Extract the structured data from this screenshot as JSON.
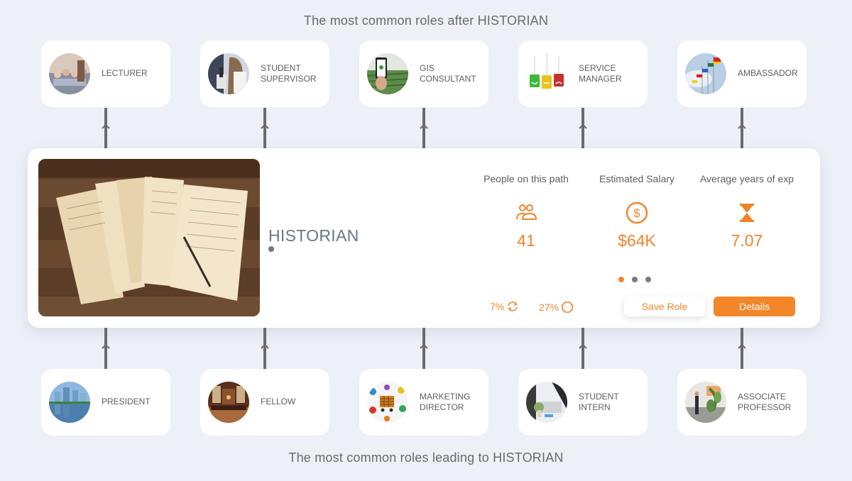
{
  "headings": {
    "top": "The most common roles after HISTORIAN",
    "bottom": "The most common roles leading to HISTORIAN"
  },
  "next_roles": [
    {
      "label": "LECTURER",
      "image": "lecture-hall-audience"
    },
    {
      "label": "STUDENT\nSUPERVISOR",
      "image": "scientist-microscope"
    },
    {
      "label": "GIS\nCONSULTANT",
      "image": "phone-over-field"
    },
    {
      "label": "SERVICE\nMANAGER",
      "image": "smiley-feedback-tags"
    },
    {
      "label": "AMBASSADOR",
      "image": "international-flags"
    }
  ],
  "previous_roles": [
    {
      "label": "PRESIDENT",
      "image": "city-skyline-reflection"
    },
    {
      "label": "FELLOW",
      "image": "library-hall"
    },
    {
      "label": "MARKETING\nDIRECTOR",
      "image": "marketing-icons-collage"
    },
    {
      "label": "STUDENT\nINTERN",
      "image": "office-desk-laptop"
    },
    {
      "label": "ASSOCIATE\nPROFESSOR",
      "image": "presentation-with-plant"
    }
  ],
  "current_role": {
    "title": "HISTORIAN",
    "image": "old-manuscripts-on-wood",
    "stats": [
      {
        "label": "People on this path",
        "icon": "people-icon",
        "value": "41"
      },
      {
        "label": "Estimated Salary",
        "icon": "dollar-circle-icon",
        "value": "$64K"
      },
      {
        "label": "Average years of exp",
        "icon": "hourglass-icon",
        "value": "7.07"
      }
    ],
    "mini_stats": [
      {
        "value": "7%",
        "icon": "refresh-icon"
      },
      {
        "value": "27%",
        "icon": "octagon-icon"
      }
    ],
    "carousel": {
      "count": 3,
      "active": 0
    },
    "buttons": {
      "save": "Save Role",
      "details": "Details"
    }
  },
  "colors": {
    "accent": "#f0842a",
    "background": "#edf0f7",
    "connector": "#6b6b6b"
  }
}
